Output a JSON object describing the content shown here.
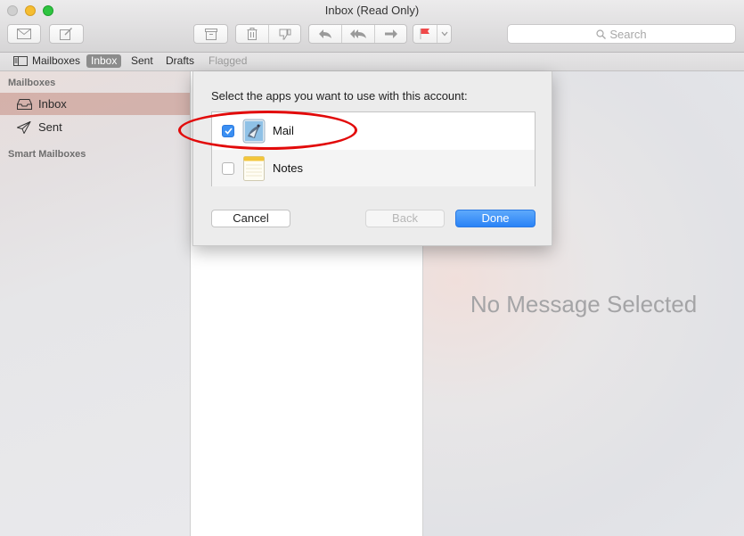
{
  "window": {
    "title": "Inbox (Read Only)"
  },
  "toolbar": {
    "get_mail": "envelope-icon",
    "compose": "compose-icon",
    "archive": "archive-icon",
    "delete": "trash-icon",
    "junk": "thumbs-down-icon",
    "reply": "reply-icon",
    "reply_all": "reply-all-icon",
    "forward": "forward-icon",
    "flag": "flag-icon",
    "flag_color": "#f0494a",
    "search_placeholder": "Search"
  },
  "favorites": {
    "mailboxes": "Mailboxes",
    "inbox": "Inbox",
    "sent": "Sent",
    "drafts": "Drafts",
    "flagged": "Flagged"
  },
  "sidebar": {
    "heading_mailboxes": "Mailboxes",
    "items": [
      {
        "label": "Inbox",
        "icon": "tray-icon",
        "selected": true
      },
      {
        "label": "Sent",
        "icon": "paper-plane-icon",
        "selected": false
      }
    ],
    "heading_smart": "Smart Mailboxes"
  },
  "viewer": {
    "empty_text": "No Message Selected"
  },
  "sheet": {
    "prompt": "Select the apps you want to use with this account:",
    "apps": [
      {
        "name": "Mail",
        "checked": true,
        "icon": "mail-app-icon"
      },
      {
        "name": "Notes",
        "checked": false,
        "icon": "notes-app-icon"
      }
    ],
    "cancel": "Cancel",
    "back": "Back",
    "done": "Done"
  },
  "colors": {
    "accent": "#2a83f6",
    "annotation": "#e20a0a"
  }
}
